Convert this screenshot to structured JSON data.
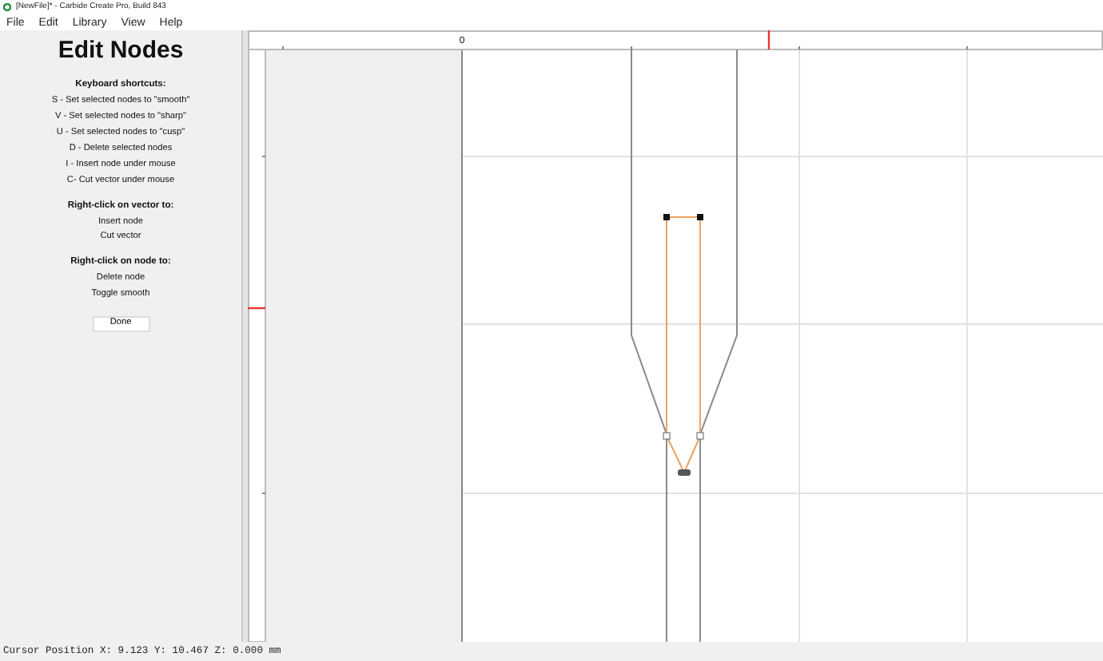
{
  "window": {
    "title": "[NewFile]* - Carbide Create Pro, Build 843"
  },
  "menu": [
    "File",
    "Edit",
    "Library",
    "View",
    "Help"
  ],
  "panel": {
    "title": "Edit Nodes",
    "sections": [
      {
        "heading": "Keyboard shortcuts:",
        "lines": [
          "S - Set selected nodes to \"smooth\"",
          "V - Set selected nodes to \"sharp\"",
          "U - Set selected nodes to \"cusp\"",
          "D - Delete selected nodes",
          "I - Insert node under mouse",
          "C- Cut vector under mouse"
        ]
      },
      {
        "heading": "Right-click on vector to:",
        "lines": [
          "Insert node",
          "Cut vector"
        ]
      },
      {
        "heading": "Right-click on node to:",
        "lines": [
          "Delete node",
          "Toggle smooth"
        ]
      }
    ],
    "button": "Done"
  },
  "ruler": {
    "origin_label": "0"
  },
  "status_bar": "Cursor Position X: 9.123 Y: 10.467 Z: 0.000 mm"
}
